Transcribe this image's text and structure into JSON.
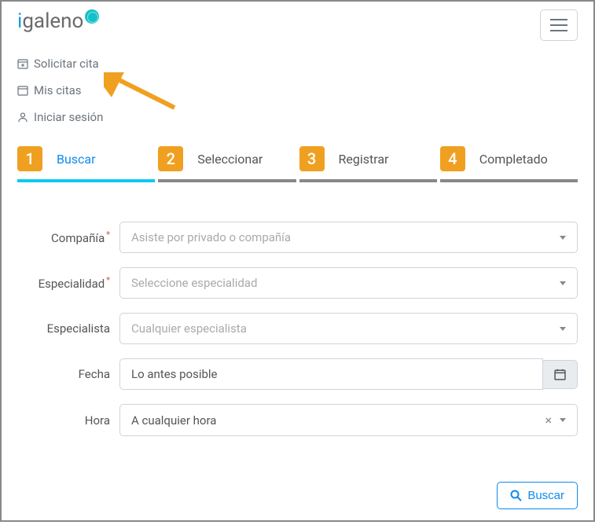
{
  "logo": {
    "part1": "i",
    "part2": "galeno"
  },
  "nav": {
    "items": [
      {
        "label": "Solicitar cita",
        "icon": "calendar-plus"
      },
      {
        "label": "Mis citas",
        "icon": "calendar"
      },
      {
        "label": "Iniciar sesión",
        "icon": "user"
      }
    ]
  },
  "wizard": {
    "steps": [
      {
        "num": "1",
        "label": "Buscar",
        "active": true
      },
      {
        "num": "2",
        "label": "Seleccionar",
        "active": false
      },
      {
        "num": "3",
        "label": "Registrar",
        "active": false
      },
      {
        "num": "4",
        "label": "Completado",
        "active": false
      }
    ]
  },
  "form": {
    "compania": {
      "label": "Compañía",
      "placeholder": "Asiste por privado o compañía",
      "required": true
    },
    "especialidad": {
      "label": "Especialidad",
      "placeholder": "Seleccione especialidad",
      "required": true
    },
    "especialista": {
      "label": "Especialista",
      "placeholder": "Cualquier especialista",
      "required": false
    },
    "fecha": {
      "label": "Fecha",
      "value": "Lo antes posible"
    },
    "hora": {
      "label": "Hora",
      "value": "A cualquier hora"
    }
  },
  "footer": {
    "search_label": "Buscar"
  },
  "required_mark": "*"
}
